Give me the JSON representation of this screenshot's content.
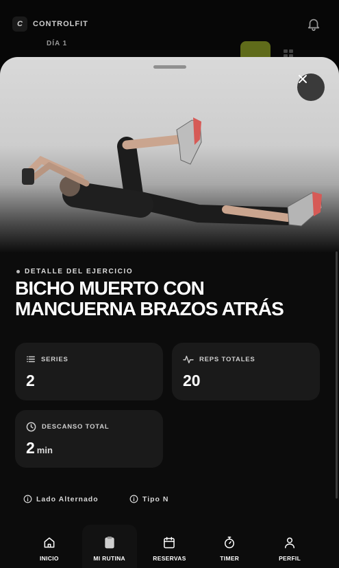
{
  "app": {
    "logo_letter": "C",
    "brand_name": "CONTROLFIT",
    "day_label": "DÍA 1"
  },
  "exercise": {
    "kicker": "DETALLE DEL EJERCICIO",
    "title": "BICHO MUERTO CON MANCUERNA BRAZOS ATRÁS"
  },
  "stats": {
    "series": {
      "label": "SERIES",
      "value": "2",
      "icon": "list-icon"
    },
    "reps": {
      "label": "REPS TOTALES",
      "value": "20",
      "icon": "pulse-icon"
    },
    "rest": {
      "label": "DESCANSO TOTAL",
      "value": "2",
      "unit": "min",
      "icon": "clock-icon"
    }
  },
  "tags": [
    {
      "label": "Lado Alternado",
      "icon": "info-icon"
    },
    {
      "label": "Tipo N",
      "icon": "info-icon"
    }
  ],
  "nav": {
    "items": [
      {
        "label": "INICIO",
        "icon": "home-icon"
      },
      {
        "label": "MI RUTINA",
        "icon": "clipboard-icon"
      },
      {
        "label": "RESERVAS",
        "icon": "calendar-icon"
      },
      {
        "label": "TIMER",
        "icon": "stopwatch-icon"
      },
      {
        "label": "PERFIL",
        "icon": "user-icon"
      }
    ]
  },
  "colors": {
    "background": "#000000",
    "card": "#1a1a1a",
    "accent_button": "#5f6b1a",
    "text": "#ffffff"
  }
}
